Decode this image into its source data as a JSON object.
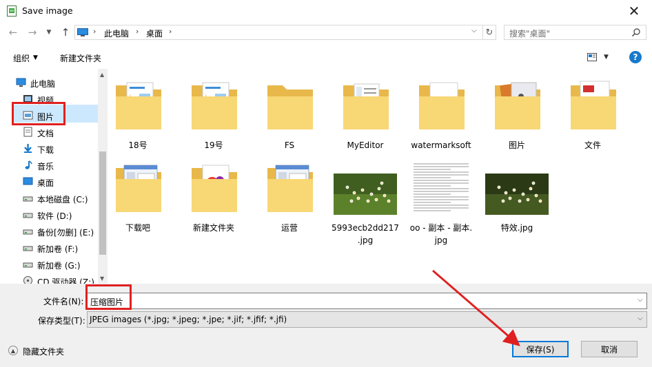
{
  "window": {
    "title": "Save image",
    "close_glyph": "✕"
  },
  "address": {
    "crumbs": [
      "此电脑",
      "桌面"
    ],
    "search_placeholder": "搜索\"桌面\""
  },
  "toolbar": {
    "organize": "组织",
    "new_folder": "新建文件夹",
    "help": "?"
  },
  "nav": {
    "items": [
      {
        "label": "此电脑",
        "icon": "computer-icon"
      },
      {
        "label": "视频",
        "icon": "video-icon"
      },
      {
        "label": "图片",
        "icon": "pictures-icon"
      },
      {
        "label": "文档",
        "icon": "document-icon"
      },
      {
        "label": "下载",
        "icon": "download-icon"
      },
      {
        "label": "音乐",
        "icon": "music-icon"
      },
      {
        "label": "桌面",
        "icon": "desktop-icon"
      },
      {
        "label": "本地磁盘 (C:)",
        "icon": "drive-icon"
      },
      {
        "label": "软件 (D:)",
        "icon": "drive-icon"
      },
      {
        "label": "备份[勿删] (E:)",
        "icon": "drive-icon"
      },
      {
        "label": "新加卷 (F:)",
        "icon": "drive-icon"
      },
      {
        "label": "新加卷 (G:)",
        "icon": "drive-icon"
      },
      {
        "label": "CD 驱动器 (Z:)",
        "icon": "cd-drive-icon"
      }
    ],
    "selected": "桌面"
  },
  "files": [
    {
      "name": "18号",
      "kind": "folder-doc"
    },
    {
      "name": "19号",
      "kind": "folder-doc"
    },
    {
      "name": "FS",
      "kind": "folder-empty"
    },
    {
      "name": "MyEditor",
      "kind": "folder-list"
    },
    {
      "name": "watermarksoft",
      "kind": "folder-white"
    },
    {
      "name": "图片",
      "kind": "folder-photo"
    },
    {
      "name": "文件",
      "kind": "folder-red"
    },
    {
      "name": "下载吧",
      "kind": "folder-window"
    },
    {
      "name": "新建文件夹",
      "kind": "folder-color"
    },
    {
      "name": "运营",
      "kind": "folder-window"
    },
    {
      "name": "5993ecb2dd217\n.jpg",
      "kind": "image-flowers"
    },
    {
      "name": "oo - 副本 - 副本.\njpg",
      "kind": "image-text"
    },
    {
      "name": "特效.jpg",
      "kind": "image-flowers-dark"
    }
  ],
  "form": {
    "filename_label": "文件名(N):",
    "filename_value": "压缩图片",
    "type_label": "保存类型(T):",
    "type_value": "JPEG images (*.jpg; *.jpeg; *.jpe; *.jif; *.jfif; *.jfi)",
    "hide_folders": "隐藏文件夹",
    "save": "保存(S)",
    "cancel": "取消"
  },
  "colors": {
    "accent": "#0078d7",
    "highlight_box": "#e02020",
    "selection": "#cce8ff",
    "folder": "#f8d775"
  }
}
